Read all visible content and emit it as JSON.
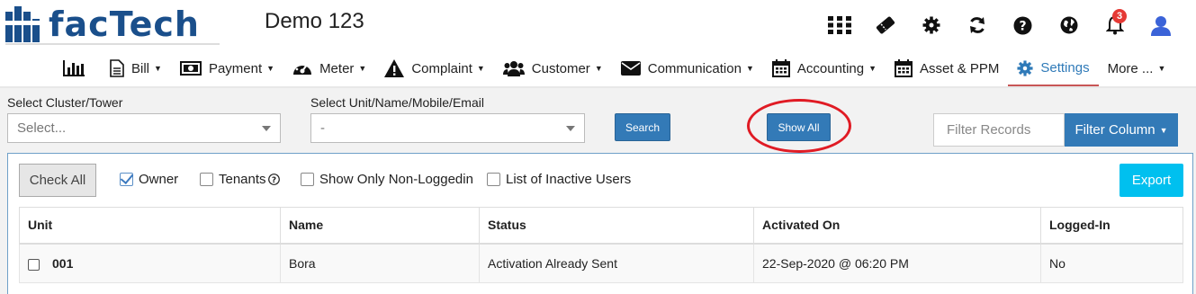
{
  "header": {
    "logo_text": "facTech",
    "app_title": "Demo 123",
    "notification_count": "3",
    "icons": [
      "apps-grid-icon",
      "ticket-icon",
      "gear-icon",
      "refresh-icon",
      "help-icon",
      "globe-icon",
      "bell-icon",
      "user-icon"
    ]
  },
  "nav": {
    "items": [
      {
        "label": "",
        "icon": "bar-chart-icon"
      },
      {
        "label": "Bill",
        "icon": "file-icon"
      },
      {
        "label": "Payment",
        "icon": "money-icon"
      },
      {
        "label": "Meter",
        "icon": "dashboard-icon"
      },
      {
        "label": "Complaint",
        "icon": "warning-icon"
      },
      {
        "label": "Customer",
        "icon": "users-icon"
      },
      {
        "label": "Communication",
        "icon": "envelope-icon"
      },
      {
        "label": "Accounting",
        "icon": "calendar-icon"
      },
      {
        "label": "Asset & PPM",
        "icon": "calendar-icon"
      },
      {
        "label": "Settings",
        "icon": "gear-icon"
      },
      {
        "label": "More ...",
        "icon": ""
      }
    ],
    "active": "Settings"
  },
  "filters": {
    "cluster_label": "Select Cluster/Tower",
    "cluster_value": "Select...",
    "unit_label": "Select Unit/Name/Mobile/Email",
    "unit_value": "-",
    "search_label": "Search",
    "show_all_label": "Show All",
    "filter_placeholder": "Filter Records",
    "filter_column_label": "Filter Column"
  },
  "panel": {
    "check_all_label": "Check All",
    "owner_label": "Owner",
    "tenants_label": "Tenants",
    "non_loggedin_label": "Show Only Non-Loggedin",
    "inactive_label": "List of Inactive Users",
    "export_label": "Export"
  },
  "table": {
    "columns": [
      "Unit",
      "Name",
      "Status",
      "Activated On",
      "Logged-In"
    ],
    "rows": [
      {
        "unit": "001",
        "name": "Bora",
        "status": "Activation Already Sent",
        "activated_on": "22-Sep-2020 @ 06:20 PM",
        "logged_in": "No"
      }
    ]
  },
  "colors": {
    "brand": "#1a4f8b",
    "accent": "#337ab7",
    "export": "#00c0ef",
    "highlight_circle": "#e01b24"
  }
}
